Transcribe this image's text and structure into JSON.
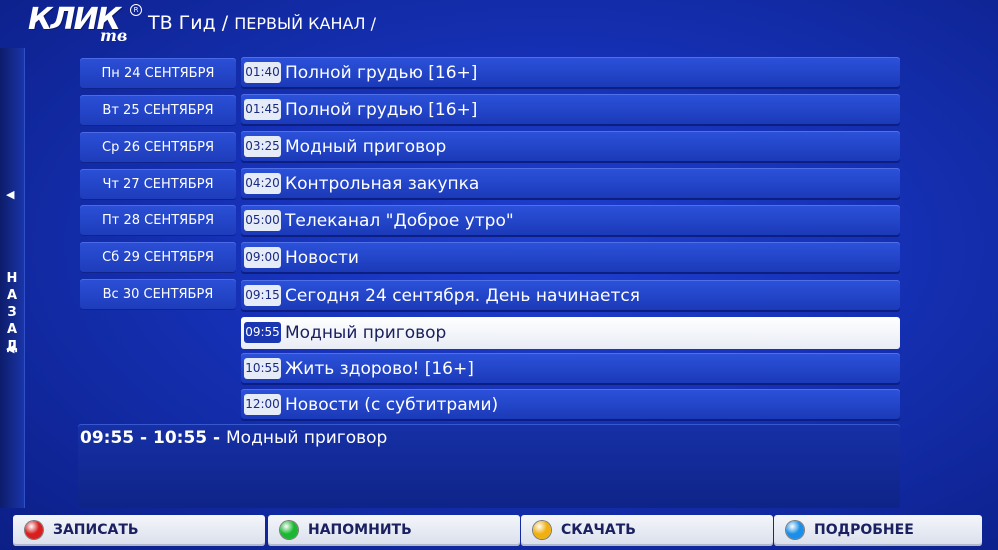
{
  "header": {
    "logo_main": "КЛИК",
    "logo_sub": "тв",
    "logo_reg": "R",
    "title": "ТВ Гид / ",
    "channel": "ПЕРВЫЙ КАНАЛ /"
  },
  "sidebar": {
    "arrow_up": "◀",
    "label": "НАЗАД",
    "arrow_down": "◀"
  },
  "days": [
    "Пн 24 СЕНТЯБРЯ",
    "Вт 25 СЕНТЯБРЯ",
    "Ср 26 СЕНТЯБРЯ",
    "Чт 27 СЕНТЯБРЯ",
    "Пт 28 СЕНТЯБРЯ",
    "Сб 29 СЕНТЯБРЯ",
    "Вс 30 СЕНТЯБРЯ"
  ],
  "programs": [
    {
      "time": "01:40",
      "name": "Полной грудью [16+]"
    },
    {
      "time": "01:45",
      "name": "Полной грудью [16+]"
    },
    {
      "time": "03:25",
      "name": "Модный приговор"
    },
    {
      "time": "04:20",
      "name": "Контрольная закупка"
    },
    {
      "time": "05:00",
      "name": "Телеканал \"Доброе утро\""
    },
    {
      "time": "09:00",
      "name": "Новости"
    },
    {
      "time": "09:15",
      "name": "Сегодня 24 сентября. День начинается"
    },
    {
      "time": "09:55",
      "name": "Модный приговор"
    },
    {
      "time": "10:55",
      "name": "Жить здорово! [16+]"
    },
    {
      "time": "12:00",
      "name": "Новости (с субтитрами)"
    }
  ],
  "info": {
    "time_range": "09:55 - 10:55 - ",
    "program": "Модный приговор"
  },
  "buttons": {
    "record": {
      "label": "ЗАПИСАТЬ",
      "color": "#d81e1e"
    },
    "remind": {
      "label": "НАПОМНИТЬ",
      "color": "#19b830"
    },
    "download": {
      "label": "СКАЧАТЬ",
      "color": "#f0b010"
    },
    "details": {
      "label": "ПОДРОБНЕЕ",
      "color": "#1a8ee8"
    }
  }
}
